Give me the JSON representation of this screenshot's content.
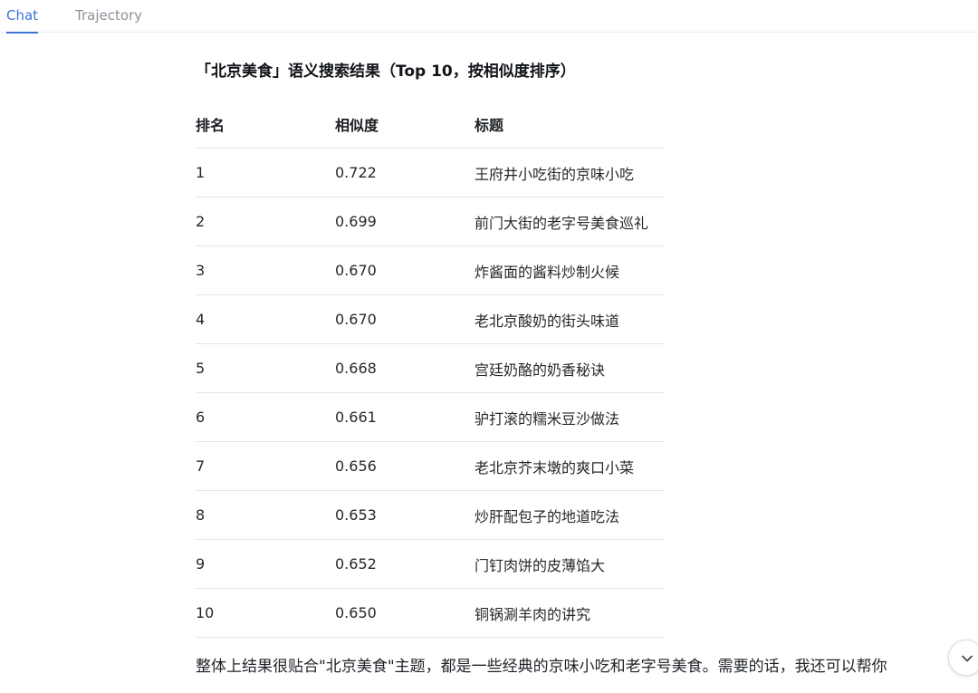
{
  "tabs": [
    {
      "label": "Chat",
      "active": true
    },
    {
      "label": "Trajectory",
      "active": false
    }
  ],
  "colors": {
    "accent": "#3b74d9",
    "inactive_tab": "#8a8f98",
    "divider": "#e3e5e8"
  },
  "message": {
    "heading": "「北京美食」语义搜索结果（Top 10，按相似度排序）",
    "table": {
      "headers": [
        "排名",
        "相似度",
        "标题"
      ],
      "rows": [
        [
          "1",
          "0.722",
          "王府井小吃街的京味小吃"
        ],
        [
          "2",
          "0.699",
          "前门大街的老字号美食巡礼"
        ],
        [
          "3",
          "0.670",
          "炸酱面的酱料炒制火候"
        ],
        [
          "4",
          "0.670",
          "老北京酸奶的街头味道"
        ],
        [
          "5",
          "0.668",
          "宫廷奶酪的奶香秘诀"
        ],
        [
          "6",
          "0.661",
          "驴打滚的糯米豆沙做法"
        ],
        [
          "7",
          "0.656",
          "老北京芥末墩的爽口小菜"
        ],
        [
          "8",
          "0.653",
          "炒肝配包子的地道吃法"
        ],
        [
          "9",
          "0.652",
          "门钉肉饼的皮薄馅大"
        ],
        [
          "10",
          "0.650",
          "铜锅涮羊肉的讲究"
        ]
      ]
    },
    "summary": "整体上结果很贴合\"北京美食\"主题，都是一些经典的京味小吃和老字号美食。需要的话，我还可以帮你"
  },
  "scroll_button": {
    "icon": "chevron-down-icon"
  }
}
